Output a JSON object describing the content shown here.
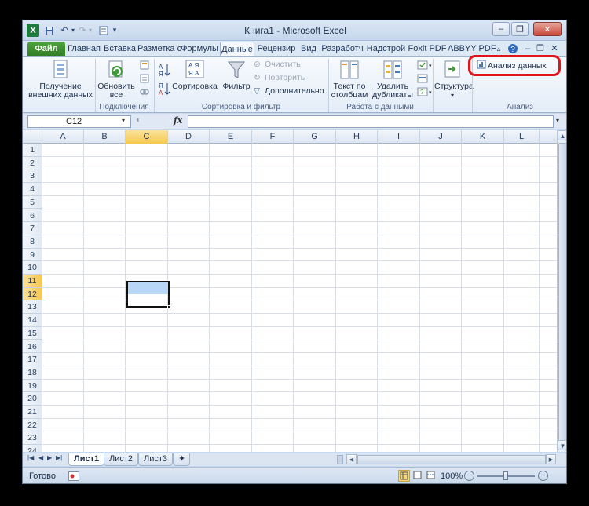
{
  "window": {
    "title": "Книга1  -  Microsoft Excel"
  },
  "quick_access": {
    "icons": [
      "excel-logo-icon",
      "save-icon",
      "undo-icon",
      "redo-icon",
      "customize-icon"
    ]
  },
  "window_controls": {
    "minimize": "–",
    "restore": "❐",
    "close": "✕"
  },
  "tabs": [
    {
      "label": "Файл",
      "kind": "file"
    },
    {
      "label": "Главная"
    },
    {
      "label": "Вставка"
    },
    {
      "label": "Разметка с"
    },
    {
      "label": "Формулы"
    },
    {
      "label": "Данные",
      "active": true
    },
    {
      "label": "Рецензир"
    },
    {
      "label": "Вид"
    },
    {
      "label": "Разработч"
    },
    {
      "label": "Надстрой"
    },
    {
      "label": "Foxit PDF"
    },
    {
      "label": "ABBYY PDF"
    }
  ],
  "ribbon": {
    "external_data": {
      "line1": "Получение",
      "line2": "внешних данных"
    },
    "refresh_all": {
      "line1": "Обновить",
      "line2": "все"
    },
    "connections_group": "Подключения",
    "sort_az": "А→Я",
    "sort": "Сортировка",
    "filter": "Фильтр",
    "clear": "Очистить",
    "reapply": "Повторить",
    "advanced": "Дополнительно",
    "sort_filter_group": "Сортировка и фильтр",
    "text_to_columns": {
      "line1": "Текст по",
      "line2": "столбцам"
    },
    "remove_duplicates": {
      "line1": "Удалить",
      "line2": "дубликаты"
    },
    "data_tools_group": "Работа с данными",
    "outline": "Структура",
    "data_analysis": "Анализ данных",
    "analysis_group": "Анализ",
    "highlight_color": "#e0161b"
  },
  "formula_bar": {
    "name_box": "C12",
    "fx": "fx",
    "formula": ""
  },
  "grid": {
    "columns": [
      "A",
      "B",
      "C",
      "D",
      "E",
      "F",
      "G",
      "H",
      "I",
      "J",
      "K",
      "L"
    ],
    "rows": [
      "1",
      "2",
      "3",
      "4",
      "5",
      "6",
      "7",
      "8",
      "9",
      "10",
      "11",
      "12",
      "13",
      "14",
      "15",
      "16",
      "17",
      "18",
      "19",
      "20",
      "21",
      "22",
      "23",
      "24"
    ],
    "selected_column": "C",
    "selected_rows": [
      "11",
      "12"
    ],
    "active_cell": "C12",
    "selection_color": "#b8d6f5"
  },
  "sheets": [
    {
      "label": "Лист1",
      "active": true
    },
    {
      "label": "Лист2"
    },
    {
      "label": "Лист3"
    }
  ],
  "status": {
    "ready": "Готово",
    "zoom": "100%"
  }
}
